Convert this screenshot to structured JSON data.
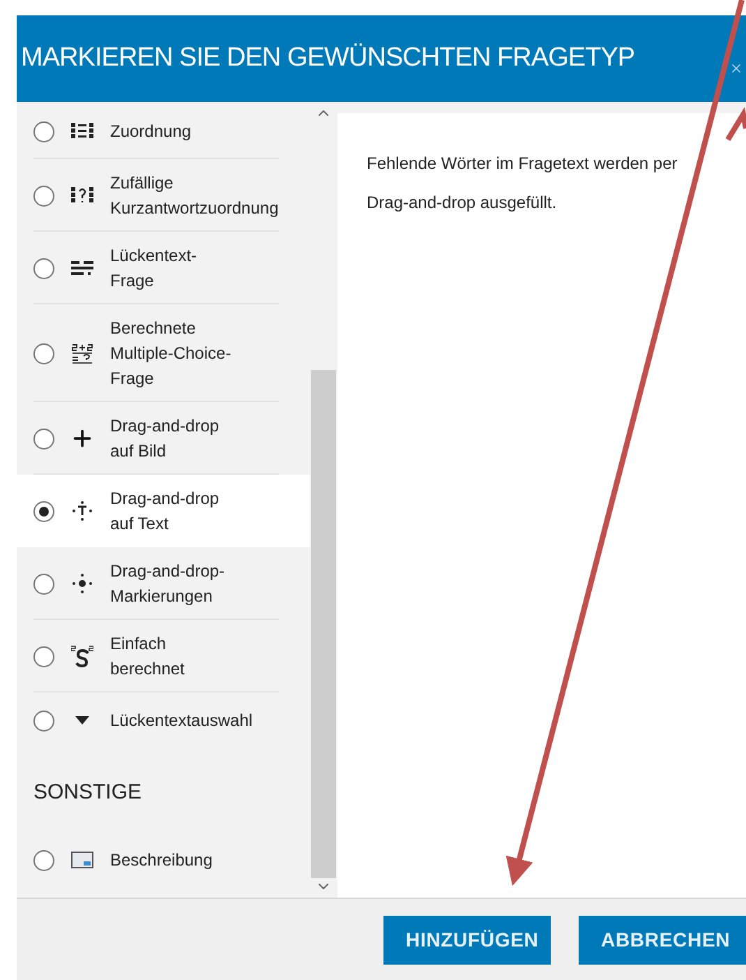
{
  "dialog": {
    "title": "MARKIEREN SIE DEN GEWÜNSCHTEN FRAGETYP"
  },
  "list": [
    {
      "kind": "option",
      "label": "Zuordnung",
      "selected": false
    },
    {
      "kind": "option",
      "label": "Zufällige Kurzantwortzuordnung",
      "selected": false
    },
    {
      "kind": "option",
      "label": "Lückentext-\nFrage",
      "selected": false
    },
    {
      "kind": "option",
      "label": "Berechnete\nMultiple-Choice-\nFrage",
      "selected": false
    },
    {
      "kind": "option",
      "label": "Drag-and-drop\nauf Bild",
      "selected": false
    },
    {
      "kind": "option",
      "label": "Drag-and-drop\nauf Text",
      "selected": true
    },
    {
      "kind": "option",
      "label": "Drag-and-drop-\nMarkierungen",
      "selected": false
    },
    {
      "kind": "option",
      "label": "Einfach\nberechnet",
      "selected": false
    },
    {
      "kind": "option",
      "label": "Lückentextauswahl",
      "selected": false
    },
    {
      "kind": "heading",
      "label": "SONSTIGE"
    },
    {
      "kind": "option",
      "label": "Beschreibung",
      "selected": false
    }
  ],
  "description": "Fehlende Wörter im Fragetext werden per Drag-and-drop ausgefüllt.",
  "buttons": [
    "HINZUFÜGEN",
    "ABBRECHEN"
  ]
}
